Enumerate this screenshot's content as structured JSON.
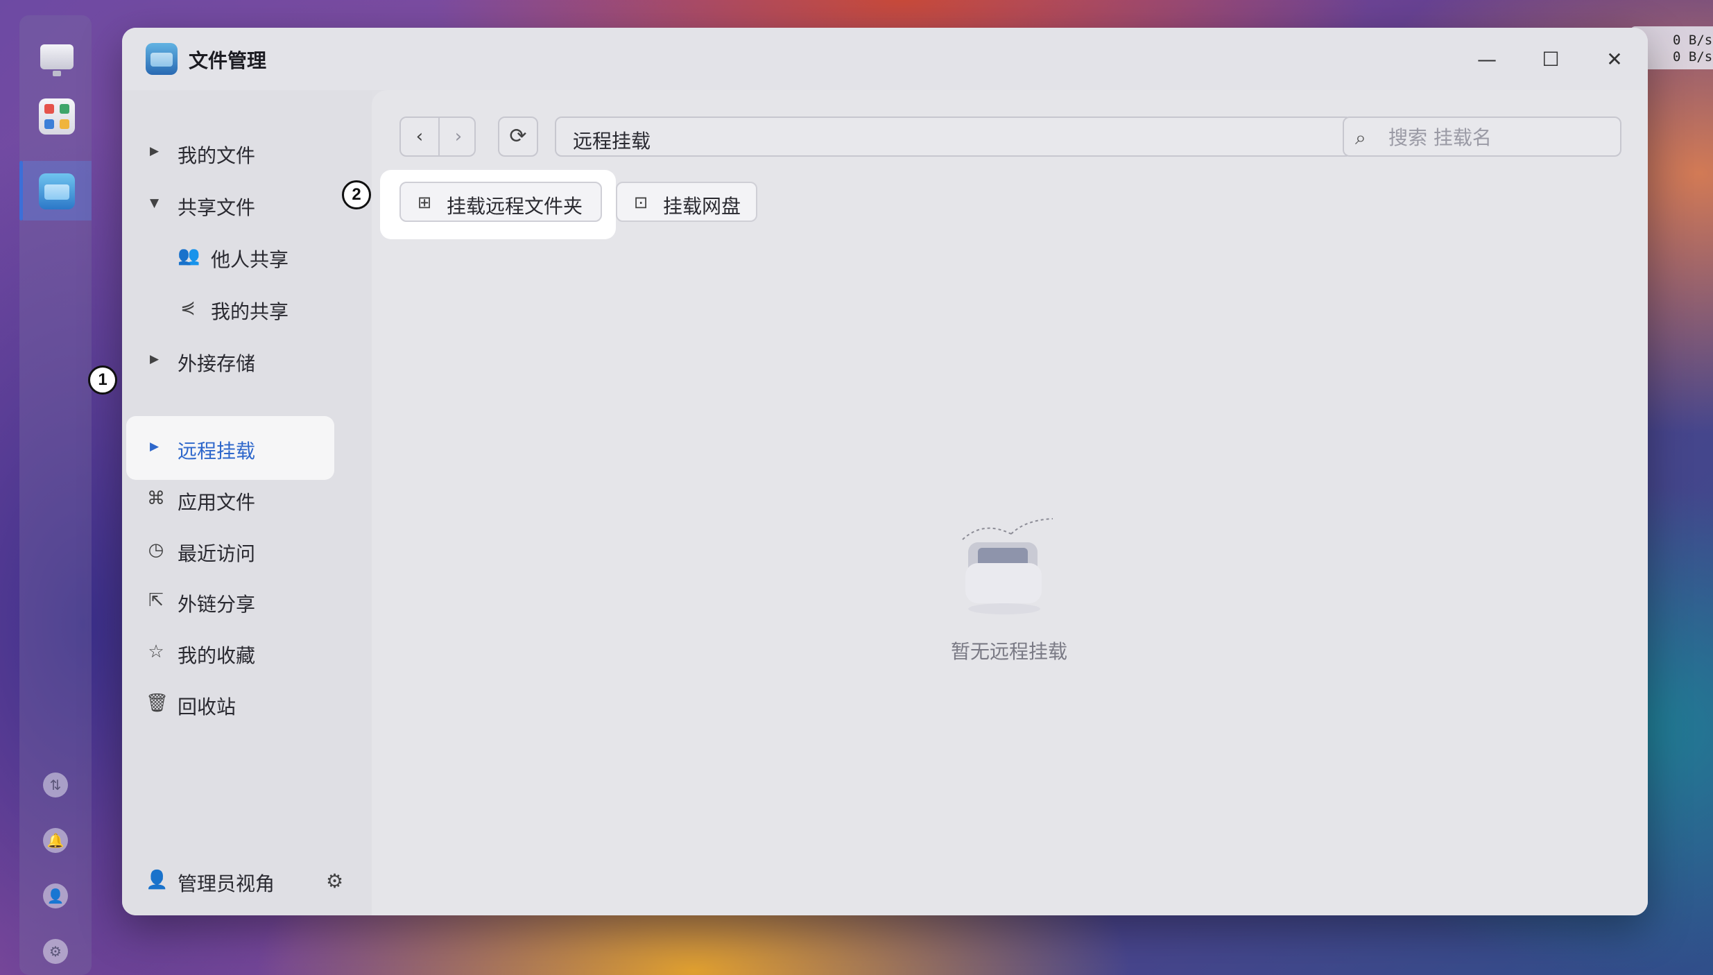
{
  "netspeed": {
    "up": "0  B/s",
    "down": "0  B/s"
  },
  "window": {
    "title": "文件管理",
    "controls": {
      "minimize": "—",
      "maximize": "☐",
      "close": "✕"
    }
  },
  "sidebar": {
    "items": [
      {
        "label": "我的文件"
      },
      {
        "label": "共享文件"
      },
      {
        "label": "他人共享"
      },
      {
        "label": "我的共享"
      },
      {
        "label": "外接存储"
      },
      {
        "label": "远程挂载"
      },
      {
        "label": "应用文件"
      },
      {
        "label": "最近访问"
      },
      {
        "label": "外链分享"
      },
      {
        "label": "我的收藏"
      },
      {
        "label": "回收站"
      }
    ],
    "footer_label": "管理员视角"
  },
  "toolbar": {
    "path": "远程挂载",
    "search_placeholder": "搜索 挂载名"
  },
  "actions": {
    "mount_folder": "挂载远程文件夹",
    "mount_netdisk": "挂载网盘"
  },
  "empty": {
    "text": "暂无远程挂载"
  },
  "annotations": {
    "step1": "1",
    "step2": "2"
  },
  "colors": {
    "accent": "#2f6bd2",
    "window_bg": "#e9e9ed"
  }
}
